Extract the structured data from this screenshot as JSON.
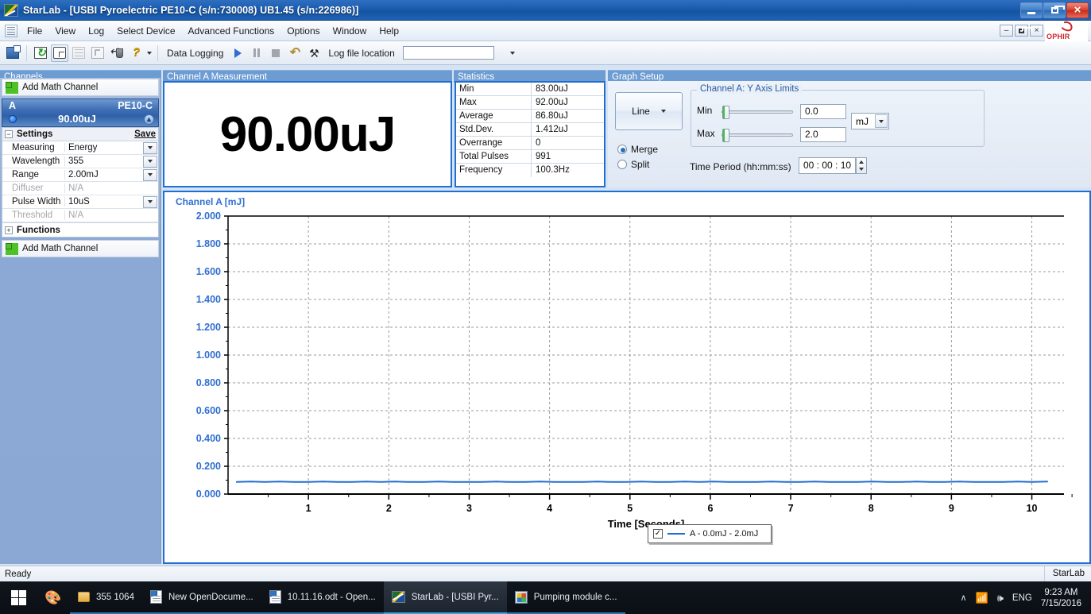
{
  "window": {
    "title": "StarLab - [USBI Pyroelectric PE10-C (s/n:730008)  UB1.45 (s/n:226986)]",
    "minimize": "–",
    "maximize": "❐",
    "close": "×",
    "mdi_minimize": "–",
    "mdi_restore": "❐",
    "mdi_close": "×",
    "brand": "OPHIR"
  },
  "menu": {
    "items": [
      "File",
      "View",
      "Log",
      "Select Device",
      "Advanced Functions",
      "Options",
      "Window",
      "Help"
    ]
  },
  "toolbar": {
    "icons": [
      "connect-icon",
      "refresh-icon",
      "new-window-icon",
      "graph-icon",
      "step-icon",
      "return-icon",
      "help-icon"
    ],
    "data_logging_label": "Data Logging",
    "play": "▶",
    "undo": "↺",
    "tools": "⚒",
    "log_file_label": "Log file location",
    "log_file_value": "",
    "log_file_placeholder": ""
  },
  "channels": {
    "panel_title": "Channels",
    "add_math_top": "Add Math Channel",
    "add_math_bottom": "Add Math Channel",
    "channel": {
      "name": "A",
      "model": "PE10-C",
      "value": "90.00uJ",
      "collapse_glyph": "»"
    },
    "settings": {
      "title": "Settings",
      "expander": "−",
      "save": "Save",
      "rows": [
        {
          "label": "Measuring",
          "value": "Energy",
          "dropdown": true,
          "disabled": false
        },
        {
          "label": "Wavelength",
          "value": "355",
          "dropdown": true,
          "disabled": false
        },
        {
          "label": "Range",
          "value": "2.00mJ",
          "dropdown": true,
          "disabled": false
        },
        {
          "label": "Diffuser",
          "value": "N/A",
          "dropdown": false,
          "disabled": true
        },
        {
          "label": "Pulse Width",
          "value": "10uS",
          "dropdown": true,
          "disabled": false
        },
        {
          "label": "Threshold",
          "value": "N/A",
          "dropdown": false,
          "disabled": true
        }
      ]
    },
    "functions": {
      "title": "Functions",
      "expander": "+"
    }
  },
  "measurement": {
    "panel_title": "Channel A Measurement",
    "value": "90.00uJ"
  },
  "statistics": {
    "panel_title": "Statistics",
    "rows": [
      {
        "label": "Min",
        "value": "83.00uJ"
      },
      {
        "label": "Max",
        "value": "92.00uJ"
      },
      {
        "label": "Average",
        "value": "86.80uJ"
      },
      {
        "label": "Std.Dev.",
        "value": "1.412uJ"
      },
      {
        "label": "Overrange",
        "value": "0"
      },
      {
        "label": "Total Pulses",
        "value": "991"
      },
      {
        "label": "Frequency",
        "value": "100.3Hz"
      }
    ]
  },
  "graph_setup": {
    "panel_title": "Graph Setup",
    "plot_type": "Line",
    "merge_label": "Merge",
    "split_label": "Split",
    "merge_selected": true,
    "axis_group_label": "Channel A: Y Axis Limits",
    "min_label": "Min",
    "min_value": "0.0",
    "max_label": "Max",
    "max_value": "2.0",
    "unit": "mJ",
    "time_period_label": "Time Period (hh:mm:ss)",
    "time_period_value": "00 : 00 : 10"
  },
  "graph": {
    "title": "Channel A [mJ]",
    "legend_text": "A - 0.0mJ - 2.0mJ",
    "legend_checked": "✓"
  },
  "chart_data": {
    "type": "line",
    "title": "Channel A [mJ]",
    "xlabel": "Time [Seconds]",
    "ylabel": "Channel A [mJ]",
    "xlim": [
      0,
      10.4
    ],
    "ylim": [
      0,
      2.0
    ],
    "xticks": [
      1,
      2,
      3,
      4,
      5,
      6,
      7,
      8,
      9,
      10
    ],
    "yticks": [
      0.0,
      0.2,
      0.4,
      0.6,
      0.8,
      1.0,
      1.2,
      1.4,
      1.6,
      1.8,
      2.0
    ],
    "ytick_labels": [
      "0.000",
      "0.200",
      "0.400",
      "0.600",
      "0.800",
      "1.000",
      "1.200",
      "1.400",
      "1.600",
      "1.800",
      "2.000"
    ],
    "grid": true,
    "legend_position": "bottom-center",
    "series": [
      {
        "name": "A - 0.0mJ - 2.0mJ",
        "color": "#1f6fd0",
        "x": [
          0.1,
          0.28,
          0.46,
          0.64,
          0.82,
          1.0,
          1.18,
          1.36,
          1.54,
          1.72,
          1.9,
          2.08,
          2.26,
          2.44,
          2.62,
          2.8,
          2.98,
          3.16,
          3.34,
          3.52,
          3.7,
          3.88,
          4.06,
          4.24,
          4.42,
          4.6,
          4.78,
          4.96,
          5.14,
          5.32,
          5.5,
          5.68,
          5.86,
          6.04,
          6.22,
          6.4,
          6.58,
          6.76,
          6.94,
          7.12,
          7.3,
          7.48,
          7.66,
          7.84,
          8.02,
          8.2,
          8.38,
          8.56,
          8.74,
          8.92,
          9.1,
          9.28,
          9.46,
          9.64,
          9.82,
          10.0,
          10.2
        ],
        "y": [
          0.087,
          0.09,
          0.087,
          0.09,
          0.087,
          0.087,
          0.09,
          0.087,
          0.087,
          0.09,
          0.087,
          0.09,
          0.087,
          0.087,
          0.09,
          0.087,
          0.087,
          0.087,
          0.09,
          0.087,
          0.087,
          0.09,
          0.087,
          0.087,
          0.087,
          0.09,
          0.087,
          0.087,
          0.09,
          0.087,
          0.087,
          0.09,
          0.087,
          0.09,
          0.087,
          0.087,
          0.087,
          0.09,
          0.087,
          0.087,
          0.09,
          0.087,
          0.087,
          0.087,
          0.09,
          0.087,
          0.087,
          0.09,
          0.087,
          0.087,
          0.09,
          0.087,
          0.087,
          0.087,
          0.09,
          0.087,
          0.09
        ]
      }
    ]
  },
  "statusbar": {
    "left": "Ready",
    "right": "StarLab"
  },
  "taskbar": {
    "items": [
      {
        "label": "355  1064",
        "icon": "folder-icon",
        "state": "open"
      },
      {
        "label": "New OpenDocume...",
        "icon": "document-icon",
        "state": "open"
      },
      {
        "label": "10.11.16.odt - Open...",
        "icon": "document-icon",
        "state": "open"
      },
      {
        "label": "StarLab - [USBI Pyr...",
        "icon": "starlab-icon",
        "state": "active"
      },
      {
        "label": "Pumping module c...",
        "icon": "pumping-icon",
        "state": "open"
      }
    ],
    "tray": {
      "chevron": "∧",
      "network": "ᴗ",
      "action_center": "▤",
      "language": "ENG"
    },
    "clock": {
      "time": "9:23 AM",
      "date": "7/15/2016"
    }
  }
}
